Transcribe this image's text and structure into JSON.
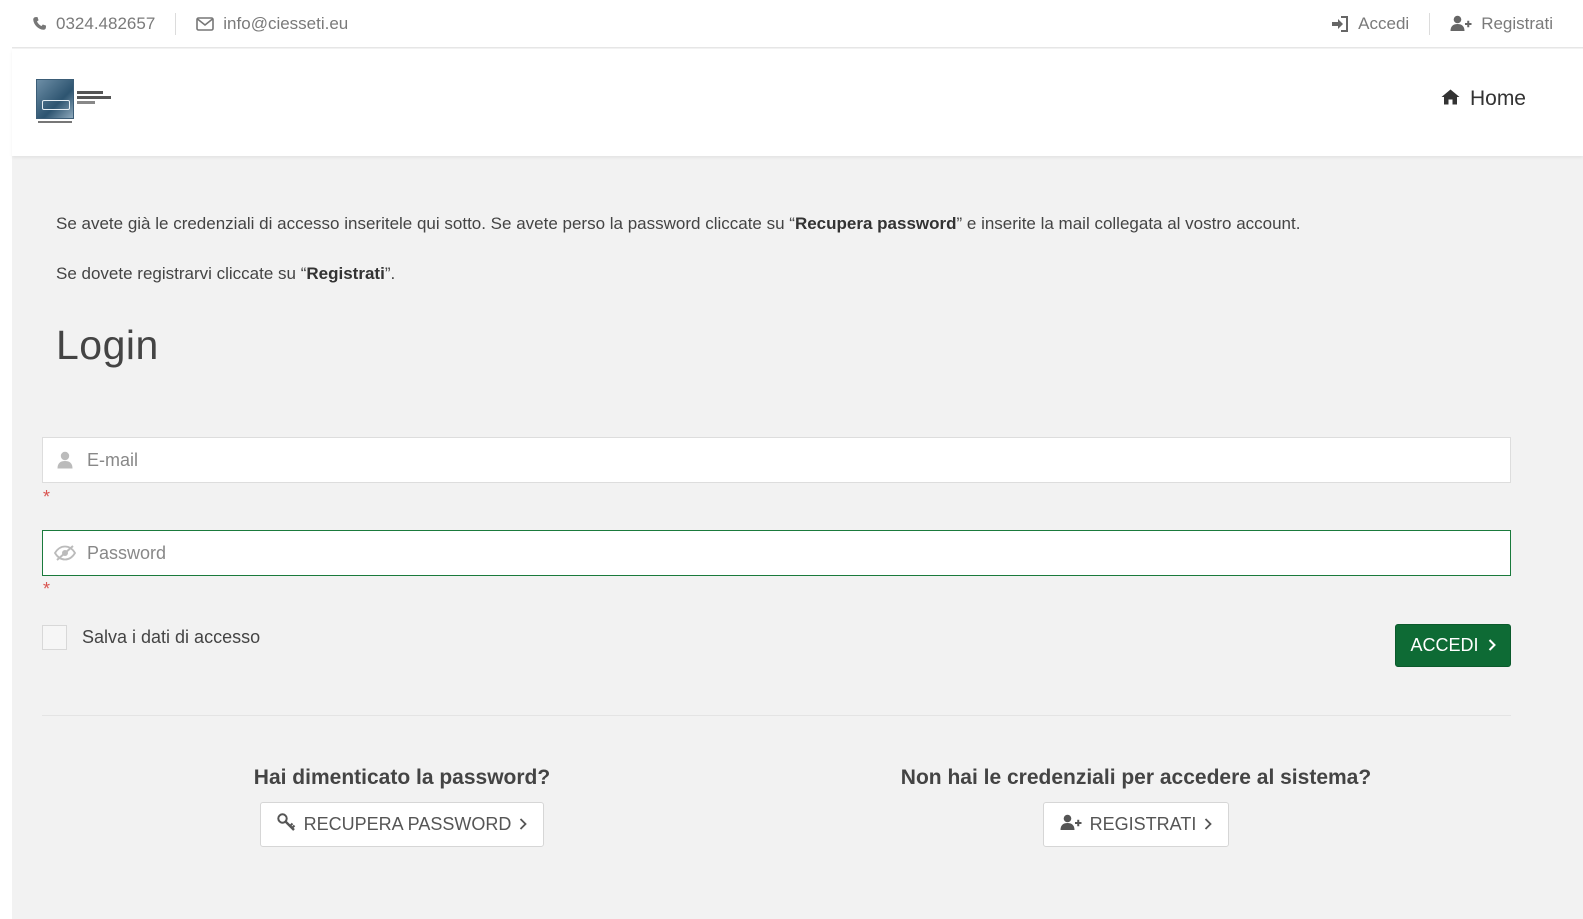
{
  "topbar": {
    "phone": "0324.482657",
    "email": "info@ciesseti.eu",
    "login_label": "Accedi",
    "register_label": "Registrati"
  },
  "header": {
    "logo_alt": "CST",
    "nav_home": "Home"
  },
  "intro": {
    "p1_before": "Se avete già le credenziali di accesso inseritele qui sotto. Se avete perso la password cliccate su “",
    "p1_bold": "Recupera password",
    "p1_after": "” e inserite la mail collegata al vostro account.",
    "p2_before": "Se dovete registrarvi cliccate su “",
    "p2_bold": "Registrati",
    "p2_after": "”."
  },
  "login": {
    "title": "Login",
    "email_placeholder": "E-mail",
    "password_placeholder": "Password",
    "required_mark": "*",
    "remember_label": "Salva i dati di accesso",
    "submit_label": "ACCEDI"
  },
  "help": {
    "forgot_title": "Hai dimenticato la password?",
    "forgot_button": "RECUPERA PASSWORD",
    "register_title": "Non hai le credenziali per accedere al sistema?",
    "register_button": "REGISTRATI"
  },
  "colors": {
    "accent": "#0e6b35",
    "required": "#d9534f",
    "background": "#f2f2f2"
  }
}
